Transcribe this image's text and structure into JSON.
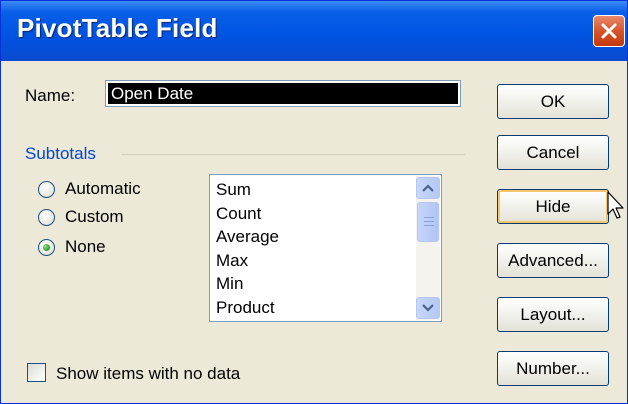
{
  "dialog": {
    "title": "PivotTable Field",
    "close_icon": "close-x-icon"
  },
  "name_field": {
    "label": "Name:",
    "value": "Open Date"
  },
  "subtotals": {
    "group_label": "Subtotals",
    "options": [
      {
        "label": "Automatic",
        "selected": false
      },
      {
        "label": "Custom",
        "selected": false
      },
      {
        "label": "None",
        "selected": true
      }
    ],
    "functions": [
      "Sum",
      "Count",
      "Average",
      "Max",
      "Min",
      "Product"
    ]
  },
  "show_items_no_data": {
    "label": "Show items with no data",
    "checked": false
  },
  "buttons": {
    "ok": "OK",
    "cancel": "Cancel",
    "hide": "Hide",
    "advanced": "Advanced...",
    "layout": "Layout...",
    "number": "Number..."
  },
  "colors": {
    "title_bar": "#0054e3",
    "accent_blue": "#0046d5",
    "close_button": "#d8542b",
    "dialog_bg": "#ece9d8"
  }
}
